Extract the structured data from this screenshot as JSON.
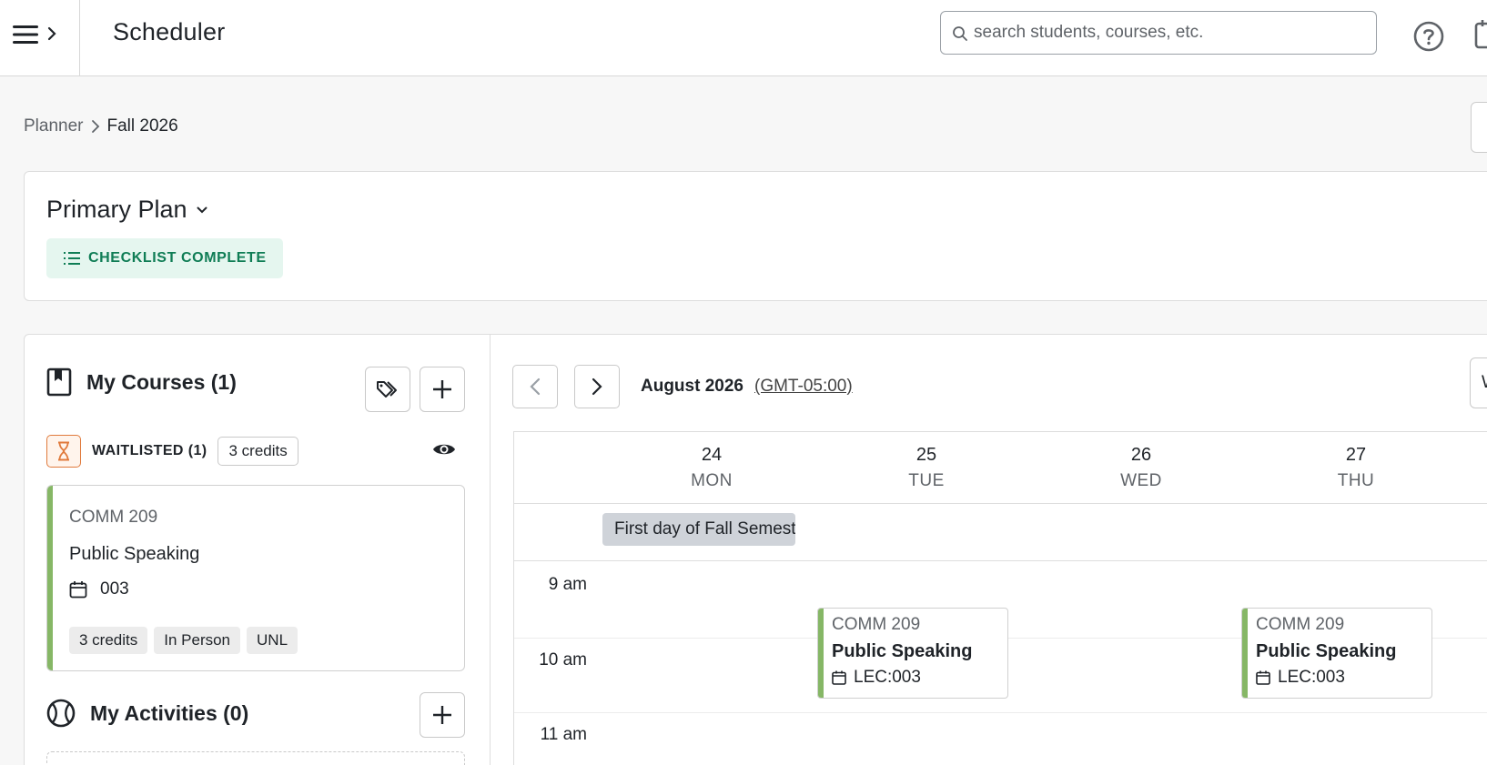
{
  "app": {
    "title": "Scheduler"
  },
  "search": {
    "placeholder": "search students, courses, etc."
  },
  "breadcrumb": {
    "parent": "Planner",
    "current": "Fall 2026"
  },
  "plan": {
    "name": "Primary Plan",
    "checklist_status": "CHECKLIST COMPLETE"
  },
  "my_courses": {
    "title": "My Courses (1)",
    "group": {
      "status": "WAITLISTED (1)",
      "credits": "3 credits"
    },
    "courses": [
      {
        "code": "COMM 209",
        "name": "Public Speaking",
        "section": "003",
        "tags": [
          "3 credits",
          "In Person",
          "UNL"
        ]
      }
    ]
  },
  "my_activities": {
    "title": "My Activities (0)"
  },
  "calendar": {
    "month": "August 2026",
    "timezone": "(GMT-05:00)",
    "view_button": "W",
    "days": [
      {
        "num": "24",
        "name": "MON"
      },
      {
        "num": "25",
        "name": "TUE"
      },
      {
        "num": "26",
        "name": "WED"
      },
      {
        "num": "27",
        "name": "THU"
      }
    ],
    "all_day_event": "First day of Fall Semester",
    "times": [
      "9 am",
      "10 am",
      "11 am"
    ],
    "events": [
      {
        "code": "COMM 209",
        "name": "Public Speaking",
        "section": "LEC:003",
        "day": "TUE"
      },
      {
        "code": "COMM 209",
        "name": "Public Speaking",
        "section": "LEC:003",
        "day": "THU"
      }
    ]
  },
  "colors": {
    "accent_green": "#86b766",
    "checklist_bg": "#e5f6ef",
    "checklist_text": "#0f7d55",
    "waitlist_orange": "#e07a3c"
  }
}
